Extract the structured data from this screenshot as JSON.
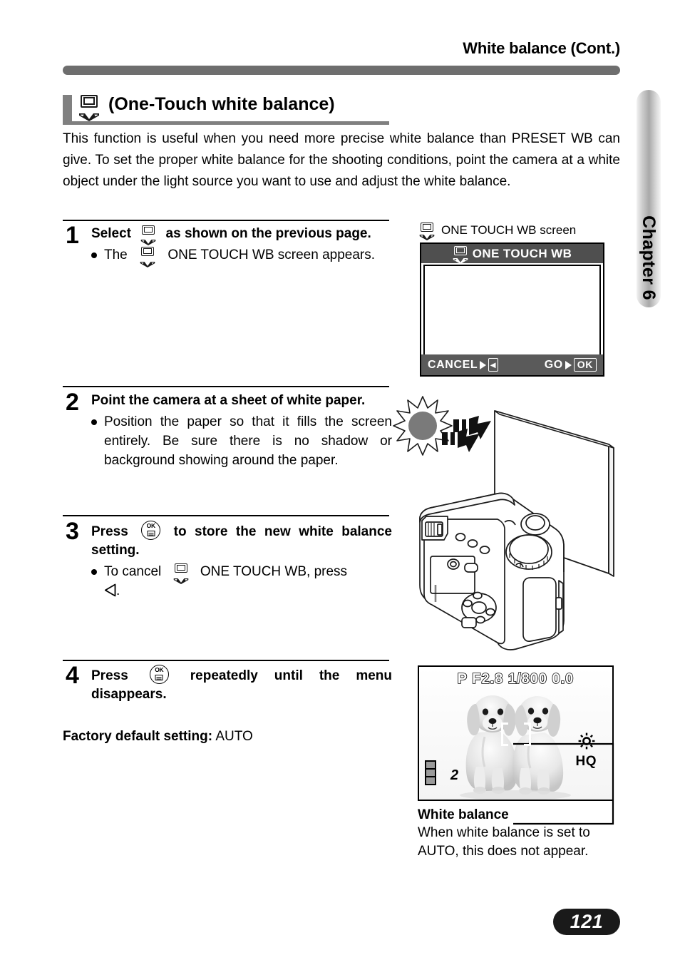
{
  "header": {
    "title": "White balance (Cont.)"
  },
  "chapter_tab": {
    "label": "Chapter 6"
  },
  "section": {
    "icon": "one-touch-wb-icon",
    "heading": "(One-Touch white balance)",
    "intro": "This function is useful when you need more precise white balance than PRESET WB can give. To set the proper white balance for the shooting conditions, point the camera at a white object under the light source you want to use and adjust the white balance."
  },
  "steps": [
    {
      "number": "1",
      "title_before": "Select",
      "title_after": "as shown on the previous page.",
      "bullet_before": "The",
      "bullet_after": "ONE TOUCH WB screen appears."
    },
    {
      "number": "2",
      "title": "Point the camera at a sheet of white paper.",
      "bullet": "Position the paper so that it fills the screen entirely. Be sure there is no shadow or background showing around the paper."
    },
    {
      "number": "3",
      "title_before": "Press",
      "title_after": "to store the new white balance setting.",
      "bullet_before": "To cancel",
      "bullet_mid": "ONE TOUCH WB, press",
      "bullet_after": "."
    },
    {
      "number": "4",
      "title_before": "Press",
      "title_after": "repeatedly until the menu disappears."
    }
  ],
  "factory_default": {
    "label": "Factory default setting:",
    "value": "AUTO"
  },
  "wb_screen": {
    "caption": "ONE TOUCH WB screen",
    "panel_title": "ONE TOUCH WB",
    "footer_cancel": "CANCEL",
    "footer_cancel_key": "◂",
    "footer_go": "GO",
    "footer_go_key": "OK"
  },
  "lcd_preview": {
    "top_info": "P F2.8 1/800  0.0",
    "shots": "2",
    "quality": "HQ",
    "wb_icon": "sun-daylight-icon",
    "battery_segments": 3
  },
  "lcd_caption": {
    "title": "White balance",
    "text": "When white balance is set to AUTO, this does not appear."
  },
  "page_number": "121",
  "colors": {
    "rule": "#6e6e6e",
    "section_bar": "#808080",
    "panel_header": "#4f4f4f",
    "panel_footer": "#5a5a5a",
    "page_pill": "#1a1a1a"
  }
}
